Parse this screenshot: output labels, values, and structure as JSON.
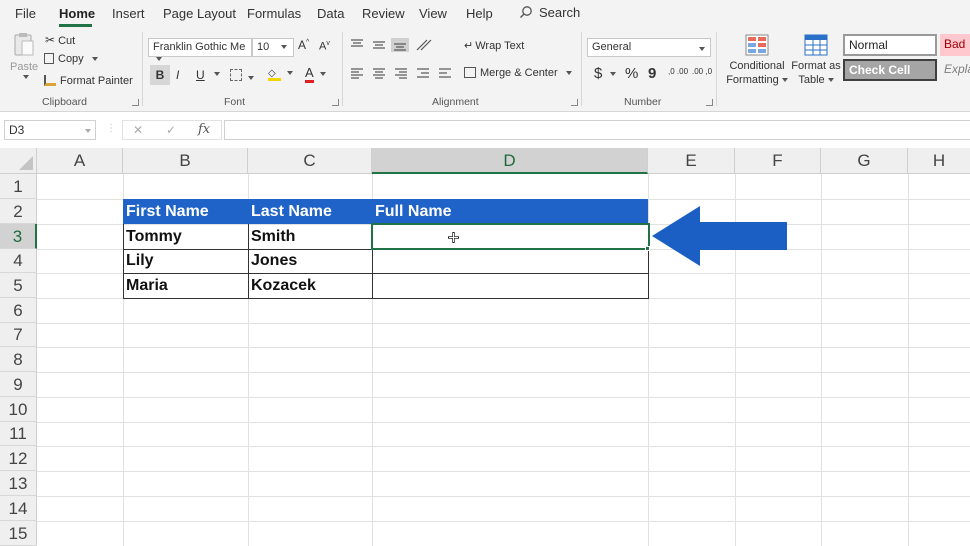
{
  "menu": {
    "tabs": [
      "File",
      "Home",
      "Insert",
      "Page Layout",
      "Formulas",
      "Data",
      "Review",
      "View",
      "Help"
    ],
    "active": "Home",
    "search_label": "Search"
  },
  "ribbon": {
    "clipboard": {
      "paste": "Paste",
      "cut": "Cut",
      "copy": "Copy",
      "format_painter": "Format Painter",
      "label": "Clipboard"
    },
    "font": {
      "font_name": "Franklin Gothic Me",
      "font_size": "10",
      "bold": "B",
      "italic": "I",
      "underline": "U",
      "label": "Font",
      "font_color_letter": "A",
      "grow": "A",
      "shrink": "A"
    },
    "alignment": {
      "wrap_text": "Wrap Text",
      "merge_center": "Merge & Center",
      "label": "Alignment"
    },
    "number": {
      "format": "General",
      "currency": "$",
      "percent": "%",
      "comma": "9",
      "inc_dec": ",0 .00",
      "dec_dec": ".00 ,0",
      "label": "Number"
    },
    "styles": {
      "conditional_formatting_1": "Conditional",
      "conditional_formatting_2": "Formatting",
      "format_as_table_1": "Format as",
      "format_as_table_2": "Table",
      "normal": "Normal",
      "bad": "Bad",
      "check_cell": "Check Cell",
      "explanatory": "Explan"
    }
  },
  "formula_bar": {
    "name_box": "D3",
    "fx": "fx",
    "cancel": "✕",
    "enter": "✓",
    "value": ""
  },
  "sheet": {
    "columns": [
      "A",
      "B",
      "C",
      "D",
      "E",
      "F",
      "G",
      "H"
    ],
    "selected_column": "D",
    "rows": [
      "1",
      "2",
      "3",
      "4",
      "5",
      "6",
      "7",
      "8",
      "9",
      "10",
      "11",
      "12",
      "13",
      "14",
      "15"
    ],
    "selected_row": "3",
    "table": {
      "headers": [
        "First Name",
        "Last Name",
        "Full Name"
      ],
      "rows": [
        [
          "Tommy",
          "Smith",
          ""
        ],
        [
          "Lily",
          "Jones",
          ""
        ],
        [
          "Maria",
          "Kozacek",
          ""
        ]
      ]
    },
    "colors": {
      "header_fill": "#1f63c9",
      "arrow": "#1b5fc4",
      "accent": "#217346"
    }
  }
}
